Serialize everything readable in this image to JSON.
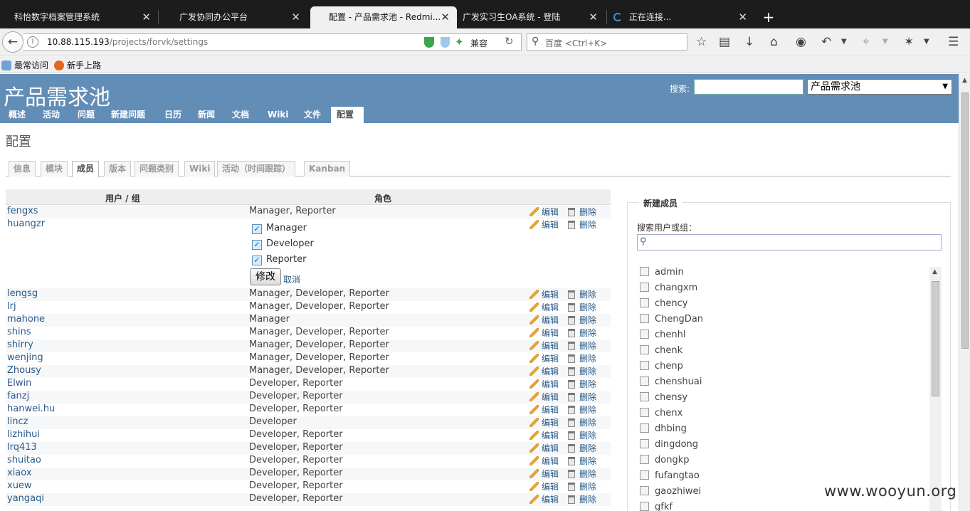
{
  "browser": {
    "tabs": [
      {
        "title": "科怡数字档案管理系统",
        "close": "✕"
      },
      {
        "title": "广发协同办公平台",
        "close": "✕"
      },
      {
        "title": "配置 - 产品需求池 - Redmi...",
        "close": "✕"
      },
      {
        "title": "广发实习生OA系统 - 登陆",
        "close": "✕"
      },
      {
        "title": "正在连接...",
        "close": "✕"
      }
    ],
    "new_tab": "+",
    "url_host": "10.88.115.193",
    "url_path": "/projects/forvk/settings",
    "compat_label": "兼容",
    "search_placeholder": "百度 <Ctrl+K>",
    "bookmarks": [
      "最常访问",
      "新手上路"
    ]
  },
  "header": {
    "project_title": "产品需求池",
    "search_label": "搜索:",
    "project_select": "产品需求池"
  },
  "menu": [
    "概述",
    "活动",
    "问题",
    "新建问题",
    "日历",
    "新闻",
    "文档",
    "Wiki",
    "文件",
    "配置"
  ],
  "content_title": "配置",
  "subtabs": [
    "信息",
    "模块",
    "成员",
    "版本",
    "问题类别",
    "Wiki",
    "活动（时间跟踪）",
    "Kanban"
  ],
  "members_table": {
    "col_user": "用户 / 组",
    "col_role": "角色",
    "edit_label": "编辑",
    "delete_label": "删除",
    "rows": [
      {
        "user": "fengxs",
        "roles": "Manager, Reporter"
      },
      {
        "user": "huangzr",
        "roles": ""
      },
      {
        "user": "lengsg",
        "roles": "Manager, Developer, Reporter"
      },
      {
        "user": "lrj",
        "roles": "Manager, Developer, Reporter"
      },
      {
        "user": "mahone",
        "roles": "Manager"
      },
      {
        "user": "shins",
        "roles": "Manager, Developer, Reporter"
      },
      {
        "user": "shirry",
        "roles": "Manager, Developer, Reporter"
      },
      {
        "user": "wenjing",
        "roles": "Manager, Developer, Reporter"
      },
      {
        "user": "Zhousy",
        "roles": "Manager, Developer, Reporter"
      },
      {
        "user": "Elwin",
        "roles": "Developer, Reporter"
      },
      {
        "user": "fanzj",
        "roles": "Developer, Reporter"
      },
      {
        "user": "hanwei.hu",
        "roles": "Developer, Reporter"
      },
      {
        "user": "lincz",
        "roles": "Developer"
      },
      {
        "user": "lizhihui",
        "roles": "Developer, Reporter"
      },
      {
        "user": "lrq413",
        "roles": "Developer, Reporter"
      },
      {
        "user": "shuitao",
        "roles": "Developer, Reporter"
      },
      {
        "user": "xiaox",
        "roles": "Developer, Reporter"
      },
      {
        "user": "xuew",
        "roles": "Developer, Reporter"
      },
      {
        "user": "yangaqi",
        "roles": "Developer, Reporter"
      }
    ],
    "edit_form": {
      "roles": [
        {
          "label": "Manager",
          "checked": true
        },
        {
          "label": "Developer",
          "checked": true
        },
        {
          "label": "Reporter",
          "checked": true
        }
      ],
      "check_mark": "✓",
      "modify_button": "修改",
      "cancel_link": "取消"
    }
  },
  "new_member": {
    "legend": "新建成员",
    "search_label": "搜索用户或组：",
    "users": [
      "admin",
      "changxm",
      "chency",
      "ChengDan",
      "chenhl",
      "chenk",
      "chenp",
      "chenshuai",
      "chensy",
      "chenx",
      "dhbing",
      "dingdong",
      "dongkp",
      "fufangtao",
      "gaozhiwei",
      "gfkf"
    ]
  },
  "watermark": "www.wooyun.org"
}
